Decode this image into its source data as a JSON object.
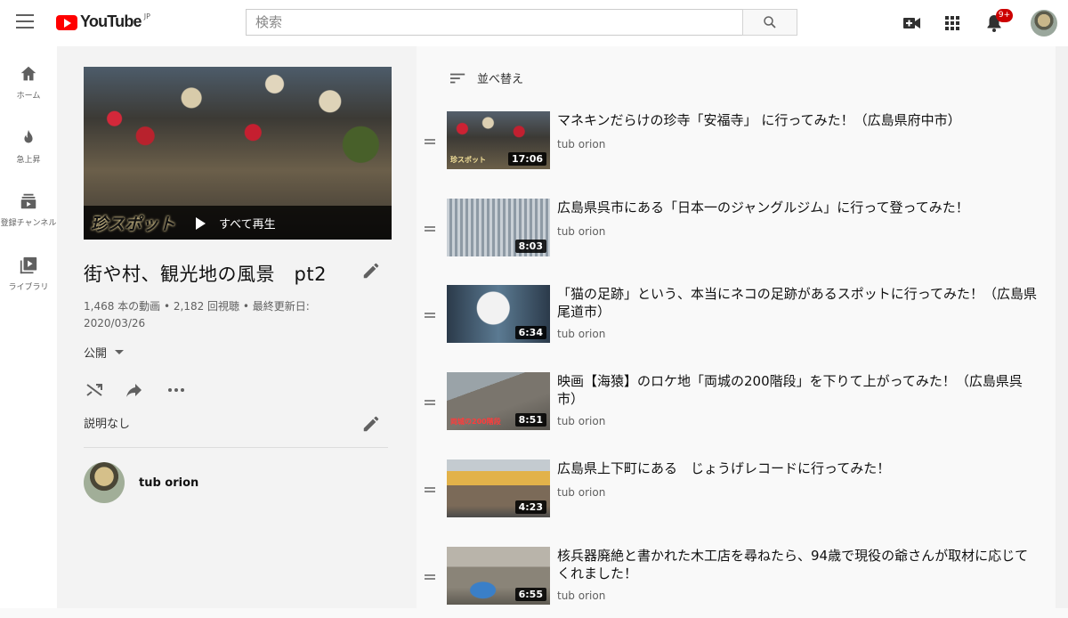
{
  "header": {
    "logo_text": "YouTube",
    "logo_region": "JP",
    "search_placeholder": "検索",
    "notification_count": "9+"
  },
  "sidebar": {
    "items": [
      {
        "label": "ホーム",
        "icon": "home-icon"
      },
      {
        "label": "急上昇",
        "icon": "flame-icon"
      },
      {
        "label": "登録チャンネル",
        "icon": "subscriptions-icon"
      },
      {
        "label": "ライブラリ",
        "icon": "library-icon"
      }
    ]
  },
  "playlist": {
    "hero_tag": "珍スポット",
    "play_all_label": "すべて再生",
    "title": "街や村、観光地の風景　pt2",
    "stats_line1": "1,468 本の動画 • 2,182 回視聴 • 最終更新日:",
    "stats_line2": "2020/03/26",
    "privacy": "公開",
    "description": "説明なし",
    "owner": "tub orion"
  },
  "list": {
    "sort_label": "並べ替え",
    "videos": [
      {
        "title": "マネキンだらけの珍寺「安福寺」 に行ってみた！（広島県府中市）",
        "owner": "tub orion",
        "duration": "17:06",
        "thumb_caption": "珍スポット"
      },
      {
        "title": "広島県呉市にある「日本一のジャングルジム」に行って登ってみた！",
        "owner": "tub orion",
        "duration": "8:03",
        "thumb_caption": ""
      },
      {
        "title": "「猫の足跡」という、本当にネコの足跡があるスポットに行ってみた！（広島県尾道市）",
        "owner": "tub orion",
        "duration": "6:34",
        "thumb_caption": ""
      },
      {
        "title": "映画【海猿】のロケ地「両城の200階段」を下りて上がってみた！（広島県呉市）",
        "owner": "tub orion",
        "duration": "8:51",
        "thumb_caption": "両城の200階段"
      },
      {
        "title": "広島県上下町にある　じょうげレコードに行ってみた！",
        "owner": "tub orion",
        "duration": "4:23",
        "thumb_caption": ""
      },
      {
        "title": "核兵器廃絶と書かれた木工店を尋ねたら、94歳で現役の爺さんが取材に応じてくれました！",
        "owner": "tub orion",
        "duration": "6:55",
        "thumb_caption": ""
      }
    ]
  }
}
